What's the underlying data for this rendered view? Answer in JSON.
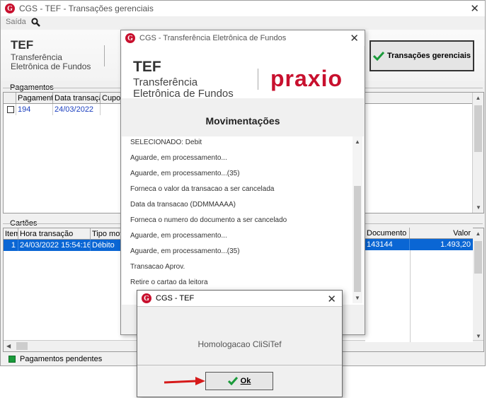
{
  "main": {
    "title": "CGS - TEF - Transações gerenciais",
    "menu": {
      "exit_label": "Saída"
    },
    "banner": {
      "tef": "TEF",
      "line1": "Transferência",
      "line2": "Eletrônica de Fundos"
    },
    "button_label": "Transações gerenciais",
    "payments": {
      "label": "Pagamentos",
      "headers": [
        "Pagamento",
        "Data transação",
        "Cupom"
      ],
      "rows": [
        {
          "pagamento": "194",
          "data": "24/03/2022"
        }
      ]
    },
    "cards": {
      "label": "Cartões",
      "headers": [
        "Item",
        "Hora transação",
        "Tipo movto",
        "Documento",
        "Valor"
      ],
      "rows": [
        {
          "item": "1",
          "hora": "24/03/2022 15:54:16",
          "tipo": "Débito",
          "documento": "143144",
          "valor": "1.493,20"
        }
      ]
    },
    "status": {
      "pending_label": "Pagamentos pendentes"
    }
  },
  "tef_window": {
    "title": "CGS - Transferência Eletrônica de Fundos",
    "banner": {
      "tef": "TEF",
      "line1": "Transferência",
      "line2": "Eletrônica de Fundos",
      "brand": "praxio"
    },
    "heading": "Movimentações",
    "log": [
      "SELECIONADO:   Debit",
      "Aguarde, em processamento...",
      "Aguarde, em processamento...(35)",
      "Forneca o valor da transacao a ser cancelada",
      "Data da transacao (DDMMAAAA)",
      "Forneca o numero do documento a ser cancelado",
      "Aguarde, em processamento...",
      "Aguarde, em processamento...(35)",
      "Transacao Aprov.",
      "Retire o cartao da leitora"
    ]
  },
  "dialog": {
    "title": "CGS - TEF",
    "message": "Homologacao CliSiTef",
    "ok_label": "Ok"
  },
  "colors": {
    "brand_red": "#c8102e",
    "selection_blue": "#0a66d4",
    "status_green": "#1a9a3a"
  }
}
